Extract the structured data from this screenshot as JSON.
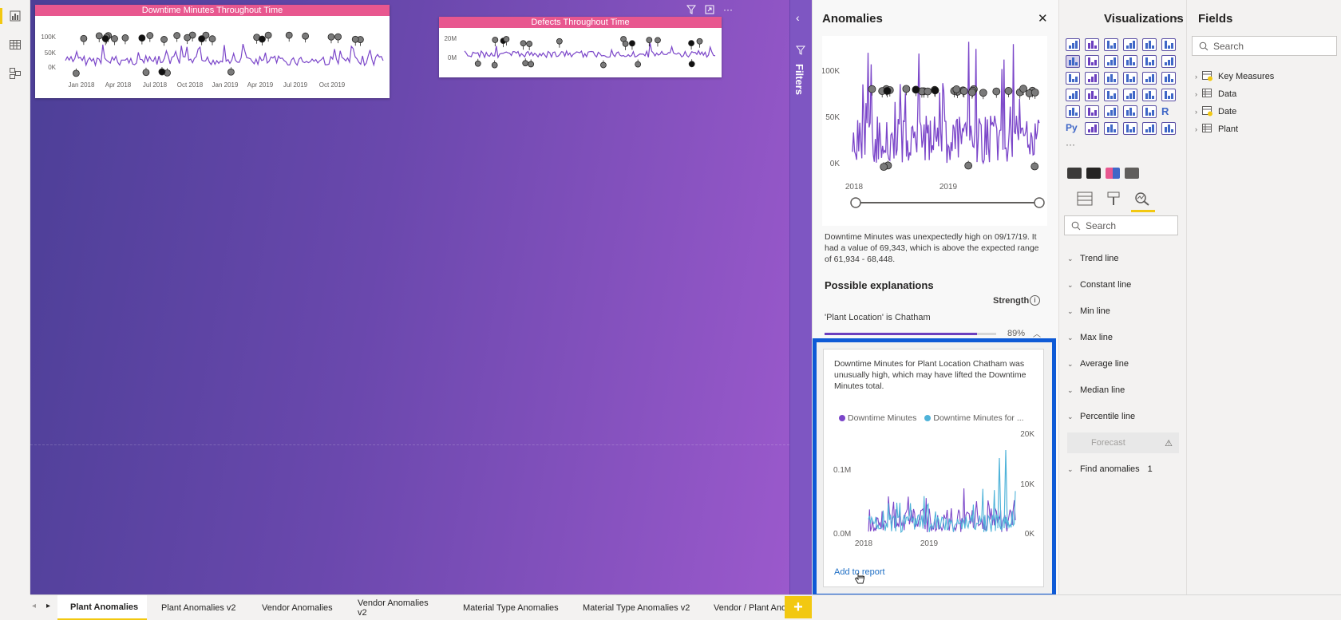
{
  "canvas": {
    "chart1": {
      "title": "Downtime Minutes Throughout Time",
      "y_ticks": [
        "100K",
        "50K",
        "0K"
      ],
      "x_ticks": [
        "Jan 2018",
        "Apr 2018",
        "Jul 2018",
        "Oct 2018",
        "Jan 2019",
        "Apr 2019",
        "Jul 2019",
        "Oct 2019"
      ]
    },
    "chart2": {
      "title": "Defects Throughout Time",
      "y_ticks": [
        "20M",
        "0M"
      ]
    }
  },
  "filters": {
    "label": "Filters"
  },
  "anomalies_pane": {
    "title": "Anomalies",
    "close_glyph": "✕",
    "main_chart": {
      "y_ticks": [
        "100K",
        "50K",
        "0K"
      ],
      "x_ticks": [
        "2018",
        "2019"
      ]
    },
    "description": "Downtime Minutes was unexpectedly high on 09/17/19. It had a value of 69,343, which is above the expected range of 61,934 - 68,448.",
    "explanations_title": "Possible explanations",
    "strength_label": "Strength",
    "explanation_item": "'Plant Location' is Chatham",
    "strength_value": "89%",
    "strength_fraction": 0.89,
    "card": {
      "text": "Downtime Minutes for Plant Location Chatham was unusually high, which may have lifted the Downtime Minutes total.",
      "legend": [
        "Downtime Minutes",
        "Downtime Minutes for ..."
      ],
      "left_ticks": [
        "0.1M",
        "0.0M"
      ],
      "right_ticks": [
        "20K",
        "10K",
        "0K"
      ],
      "x_ticks": [
        "2018",
        "2019"
      ],
      "add_link": "Add to report"
    }
  },
  "viz_pane": {
    "title": "Visualizations",
    "search_placeholder": "Search",
    "analytics_rows": [
      {
        "label": "Trend line"
      },
      {
        "label": "Constant line"
      },
      {
        "label": "Min line"
      },
      {
        "label": "Max line"
      },
      {
        "label": "Average line"
      },
      {
        "label": "Median line"
      },
      {
        "label": "Percentile line"
      },
      {
        "label": "Forecast"
      },
      {
        "label": "Find anomalies",
        "count": "1"
      }
    ],
    "more_glyph": "···",
    "py_label": "Py",
    "r_label": "R"
  },
  "fields_pane": {
    "title": "Fields",
    "search_placeholder": "Search",
    "items": [
      "Key Measures",
      "Data",
      "Date",
      "Plant"
    ]
  },
  "tabs": [
    "Plant Anomalies",
    "Plant Anomalies v2",
    "Vendor Anomalies",
    "Vendor Anomalies v2",
    "Material Type Anomalies",
    "Material Type Anomalies v2",
    "Vendor / Plant Ano"
  ],
  "add_page_glyph": "+",
  "colors": {
    "accent_yellow": "#f2c811",
    "series_purple": "#7b46c9",
    "series_teal": "#4fb3d9",
    "highlight_blue": "#0e5ad6",
    "title_pink": "#e8578f"
  }
}
